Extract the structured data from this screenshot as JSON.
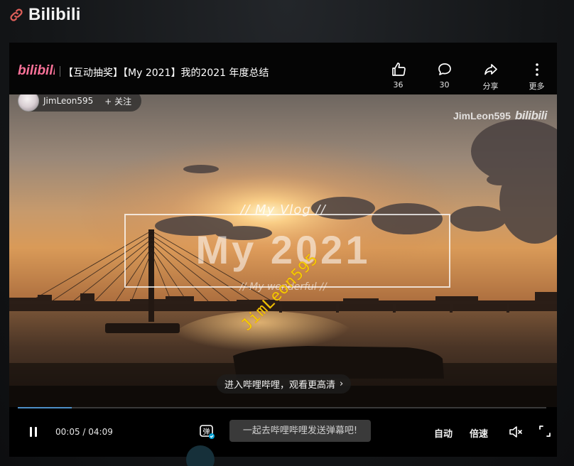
{
  "topbar": {
    "icon": "link-icon",
    "title": "Bilibili"
  },
  "player": {
    "brand": "bilibili",
    "video_title": "【互动抽奖】【My 2021】我的2021 年度总结",
    "actions": [
      {
        "icon": "thumbs-up-icon",
        "label": "36"
      },
      {
        "icon": "comment-icon",
        "label": "30"
      },
      {
        "icon": "share-icon",
        "label": "分享"
      },
      {
        "icon": "more-icon",
        "label": "更多"
      }
    ],
    "uploader": {
      "name": "JimLeon595",
      "follow_label": "+ 关注"
    }
  },
  "video": {
    "watermark_user": "JimLeon595",
    "watermark_brand": "bilibili",
    "overlay_sub": "//  My Vlog  //",
    "overlay_main": "My 2021",
    "overlay_tag": "//    My wonderful    //",
    "diagonal_watermark": "JimLeon595",
    "open_app_prompt": "进入哔哩哔哩，观看更高清",
    "open_app_chevron": "›"
  },
  "controls": {
    "progress_fraction": 0.102,
    "time_current": "00:05",
    "time_sep": " / ",
    "time_total": "04:09",
    "danmaku_placeholder": "一起去哔哩哔哩发送弹幕吧!",
    "auto_label": "自动",
    "speed_label": "倍速",
    "colors": {
      "progress": "#4d8fc7",
      "brand_pink": "#fb7299"
    }
  }
}
